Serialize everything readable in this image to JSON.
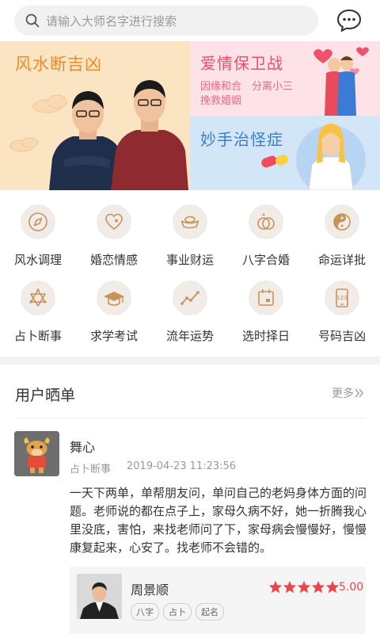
{
  "search": {
    "placeholder": "请输入大师名字进行搜索"
  },
  "header": {
    "chat_icon": "chat-bubble-icon"
  },
  "banners": {
    "left": {
      "title": "风水断吉凶"
    },
    "right_top": {
      "title": "爱情保卫战",
      "line1": "因缘和合　分离小三",
      "line2": "挽救婚姻"
    },
    "right_bottom": {
      "title": "妙手治怪症"
    }
  },
  "categories": [
    {
      "label": "风水调理",
      "icon": "compass-icon"
    },
    {
      "label": "婚恋情感",
      "icon": "heart-icon"
    },
    {
      "label": "事业财运",
      "icon": "ingot-icon"
    },
    {
      "label": "八字合婚",
      "icon": "rings-icon"
    },
    {
      "label": "命运详批",
      "icon": "yin-yang-icon"
    },
    {
      "label": "占卜断事",
      "icon": "hexagram-icon"
    },
    {
      "label": "求学考试",
      "icon": "graduation-cap-icon"
    },
    {
      "label": "流年运势",
      "icon": "trend-line-icon"
    },
    {
      "label": "选时择日",
      "icon": "calendar-icon"
    },
    {
      "label": "号码吉凶",
      "icon": "phone-number-icon"
    }
  ],
  "reviews": {
    "title": "用户晒单",
    "more": "更多",
    "item": {
      "user": "舞心",
      "tag": "占卜断事",
      "time": "2019-04-23 11:23:56",
      "content": "一天下两单，单帮朋友问，单问自己的老妈身体方面的问题。老师说的都在点子上，家母久病不好，她一折腾我心里没底，害怕，来找老师问了下，家母病会慢慢好，慢慢康复起来，心安了。找老师不会错的。",
      "master": {
        "name": "周景顺",
        "rating": 5,
        "score": "5.00",
        "tags": [
          "八字",
          "占卜",
          "起名"
        ]
      }
    }
  },
  "colors": {
    "accent": "#ef8a2a",
    "rating": "#e8474b",
    "icon_stroke": "#c7935a"
  }
}
